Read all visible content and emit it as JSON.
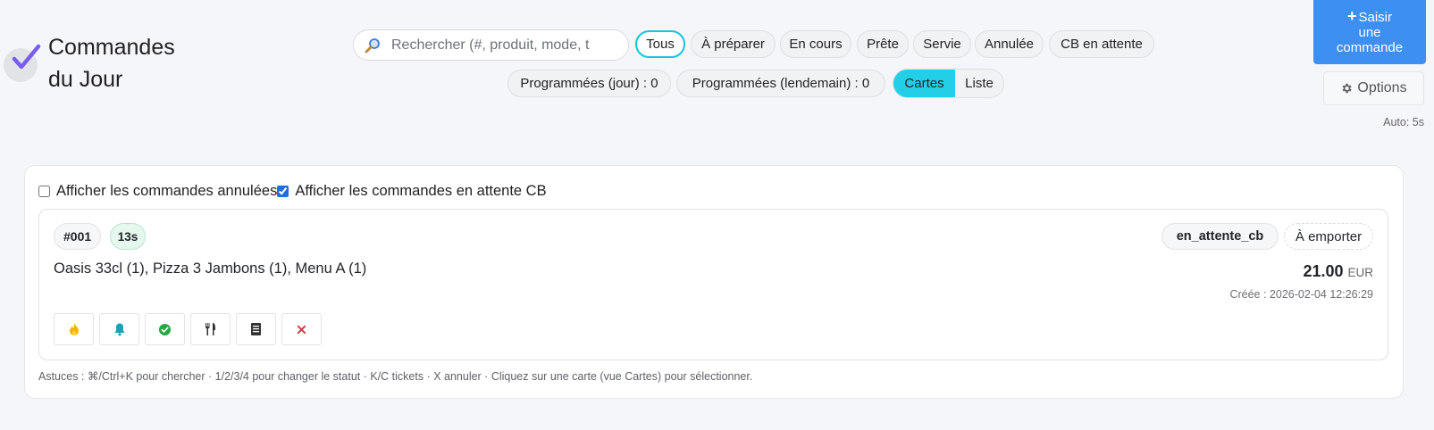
{
  "header": {
    "title_line1": "Commandes",
    "title_line2": "du Jour",
    "search": {
      "placeholder": "Rechercher (#, produit, mode, t"
    },
    "status_filters": [
      {
        "label": "Tous",
        "active": true
      },
      {
        "label": "À préparer"
      },
      {
        "label": "En cours"
      },
      {
        "label": "Prête"
      },
      {
        "label": "Servie"
      },
      {
        "label": "Annulée"
      },
      {
        "label": "CB en attente"
      }
    ],
    "scheduled_today": "Programmées (jour) : 0",
    "scheduled_tomorrow": "Programmées (lendemain) : 0",
    "view_toggle": {
      "cards": "Cartes",
      "list": "Liste",
      "selected": "Cartes"
    },
    "new_order_button": {
      "line1": "Saisir",
      "line2": "une",
      "line3": "commande"
    },
    "options_button": "Options",
    "auto_refresh": "Auto: 5s"
  },
  "filters": {
    "show_cancelled": {
      "label": "Afficher les commandes annulées",
      "checked": false
    },
    "show_cb_pending": {
      "label": "Afficher les commandes en attente CB",
      "checked": true
    }
  },
  "orders": [
    {
      "number": "#001",
      "elapsed": "13s",
      "status": "en_attente_cb",
      "mode": "À emporter",
      "items": "Oasis 33cl (1), Pizza 3 Jambons (1), Menu A (1)",
      "total": "21.00",
      "currency": "EUR",
      "created": "Créée : 2026-02-04 12:26:29",
      "actions": [
        "flame-icon",
        "bell-icon",
        "check-circle-icon",
        "utensils-icon",
        "receipt-icon",
        "close-icon"
      ]
    }
  ],
  "tips": "Astuces : ⌘/Ctrl+K pour chercher · 1/2/3/4 pour changer le statut · K/C tickets · X annuler · Cliquez sur une carte (vue Cartes) pour sélectionner.",
  "colors": {
    "accent": "#22cfe6",
    "primary_button": "#3d8ff2",
    "active_border": "#16c4dd",
    "timer_bg": "#e6f7ee",
    "logo_check": "#7b5cf0"
  }
}
